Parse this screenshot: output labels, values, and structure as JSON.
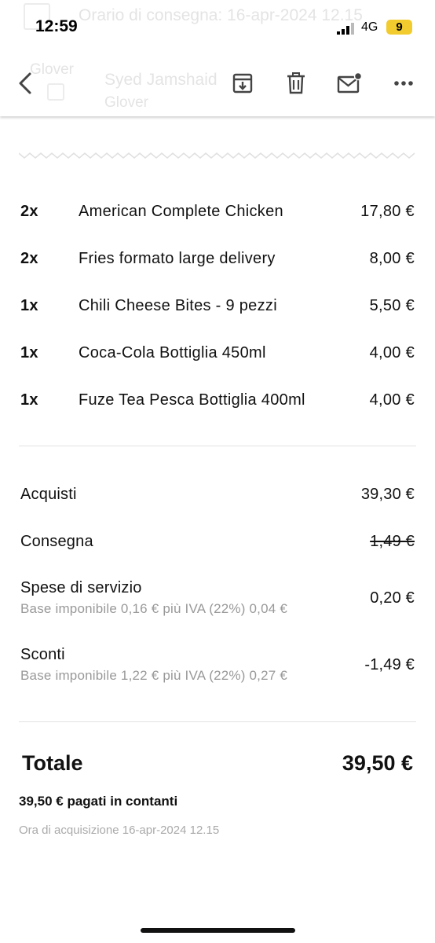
{
  "status_bar": {
    "time": "12:59",
    "network": "4G",
    "battery": "9"
  },
  "background_email": {
    "subject_line": "Orario di consegna: 16-apr-2024 12.15",
    "app_label": "Glover",
    "sender": "Syed Jamshaid",
    "sender_sub": "Glover"
  },
  "toolbar": {
    "back_icon": "chevron-left-icon",
    "archive_icon": "archive-icon",
    "delete_icon": "trash-icon",
    "unread_icon": "mail-unread-icon",
    "more_icon": "more-icon"
  },
  "items": [
    {
      "qty": "2x",
      "name": "American Complete Chicken",
      "price": "17,80 €"
    },
    {
      "qty": "2x",
      "name": "Fries formato large delivery",
      "price": "8,00 €"
    },
    {
      "qty": "1x",
      "name": "Chili Cheese Bites - 9 pezzi",
      "price": "5,50 €"
    },
    {
      "qty": "1x",
      "name": "Coca-Cola Bottiglia 450ml",
      "price": "4,00 €"
    },
    {
      "qty": "1x",
      "name": "Fuze Tea Pesca Bottiglia 400ml",
      "price": "4,00 €"
    }
  ],
  "summary": {
    "acquisti_label": "Acquisti",
    "acquisti_value": "39,30 €",
    "consegna_label": "Consegna",
    "consegna_value": "1,49 €",
    "servizio_label": "Spese di servizio",
    "servizio_sub": "Base imponibile 0,16 € più IVA (22%) 0,04 €",
    "servizio_value": "0,20 €",
    "sconti_label": "Sconti",
    "sconti_sub": "Base imponibile 1,22 € più IVA (22%) 0,27 €",
    "sconti_value": "-1,49 €"
  },
  "total": {
    "label": "Totale",
    "value": "39,50 €"
  },
  "payment": "39,50 € pagati in contanti",
  "acquisition": "Ora di acquisizione 16-apr-2024 12.15"
}
